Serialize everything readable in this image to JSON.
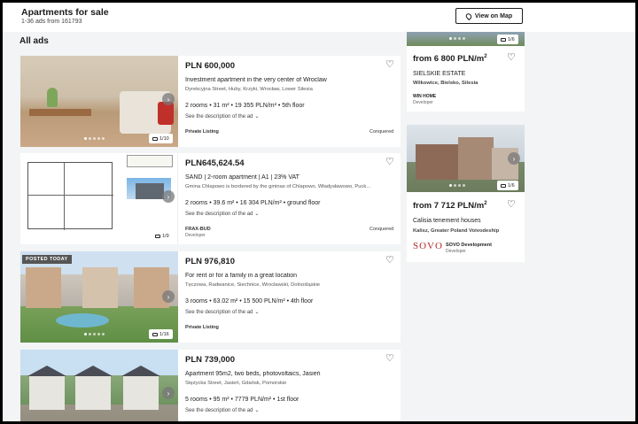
{
  "header": {
    "title": "Apartments for sale",
    "subtitle": "1-36 ads from 161793",
    "map_button": "View on Map"
  },
  "section_title": "All ads",
  "listings": [
    {
      "price": "PLN 600,000",
      "title": "Investment apartment in the very center of Wroclaw",
      "address": "Dyrekcyjna Street, Huby, Krzyki, Wrocław, Lower Silesia",
      "params": "2 rooms • 31 m² • 19 355 PLN/m² • 5th floor",
      "description_link": "See the description of the ad",
      "seller": "Private Listing",
      "seller_type": "",
      "status": "Conquered",
      "photo_counter": "1/10",
      "badge": ""
    },
    {
      "price": "PLN645,624.54",
      "title": "SAND | 2-room apartment | A1 | 23% VAT",
      "address": "Gmina Chlapowo is bordered by the gminas of Chlapowo, Władysławowo, Puck...",
      "params": "2 rooms • 39.6 m² • 16 304 PLN/m² • ground floor",
      "description_link": "See the description of the ad",
      "seller": "FRAX-BUD",
      "seller_type": "Developer",
      "status": "Conquered",
      "photo_counter": "1/9",
      "badge": ""
    },
    {
      "price": "PLN 976,810",
      "title": "For rent or for a family in a great location",
      "address": "Tęczowa, Radwanice, Siechnice, Wrocławski, Dolnośląskie",
      "params": "3 rooms • 63.02 m² • 15 500 PLN/m² • 4th floor",
      "description_link": "See the description of the ad",
      "seller": "Private Listing",
      "seller_type": "",
      "status": "",
      "photo_counter": "1/16",
      "badge": "POSTED TODAY"
    },
    {
      "price": "PLN 739,000",
      "title": "Apartment 95m2, two beds, photovoltaics, Jasień",
      "address": "Stężycka Street, Jasień, Gdańsk, Pomorskie",
      "params": "5 rooms • 95 m² • 7779 PLN/m² • 1st floor",
      "description_link": "See the description of the ad",
      "seller": "",
      "seller_type": "",
      "status": "",
      "photo_counter": "",
      "badge": ""
    }
  ],
  "investments": [
    {
      "photo_counter": "1/6",
      "price_prefix": "from 6 800 PLN/m",
      "price_sup": "2",
      "title": "SIELSKIE ESTATE",
      "location": "Wilkowice, Bielsko, Silesia",
      "developer_name": "WIN HOME",
      "developer_type": "Developer"
    },
    {
      "photo_counter": "1/6",
      "price_prefix": "from 7 712 PLN/m",
      "price_sup": "2",
      "title": "Calisia tenement houses",
      "location": "Kalisz, Greater Poland Voivodeship",
      "developer_logo": "SOVO",
      "developer_name": "SOVO Development",
      "developer_type": "Developer"
    }
  ],
  "icons": {
    "heart": "heart-outline-icon",
    "camera": "camera-icon",
    "pin": "map-pin-icon",
    "arrow": "chevron-right-icon"
  }
}
